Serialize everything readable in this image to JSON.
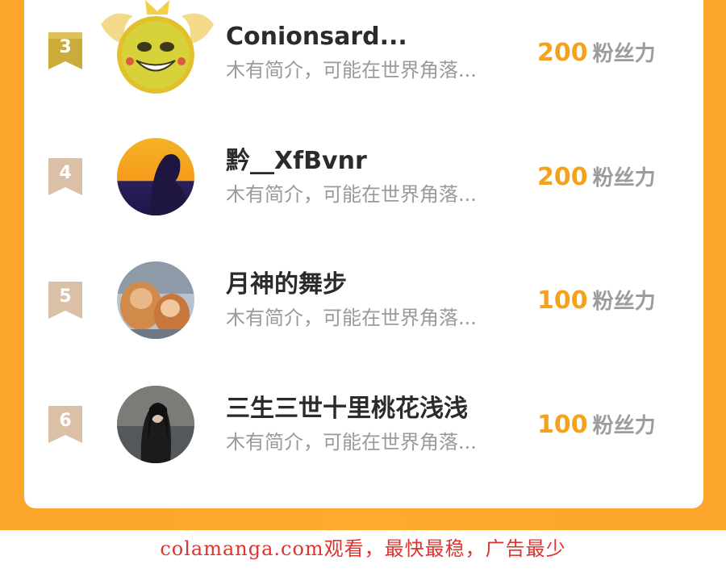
{
  "rankings": [
    {
      "rank": "3",
      "name": "Conionsard...",
      "description": "木有简介，可能在世界角落...",
      "score": "200",
      "score_unit": "粉丝力",
      "avatar": "yellow-meme-face-avatar",
      "crowned": true
    },
    {
      "rank": "4",
      "name": "黔__XfBvnr",
      "description": "木有简介，可能在世界角落...",
      "score": "200",
      "score_unit": "粉丝力",
      "avatar": "sunset-silhouette-avatar",
      "crowned": false
    },
    {
      "rank": "5",
      "name": "月神的舞步",
      "description": "木有简介，可能在世界角落...",
      "score": "100",
      "score_unit": "粉丝力",
      "avatar": "two-cats-avatar",
      "crowned": false
    },
    {
      "rank": "6",
      "name": "三生三世十里桃花浅浅",
      "description": "木有简介，可能在世界角落...",
      "score": "100",
      "score_unit": "粉丝力",
      "avatar": "dark-haired-figure-avatar",
      "crowned": false
    }
  ],
  "footer": {
    "watermark": "colamanga.com观看，最快最稳，广告最少"
  },
  "colors": {
    "background_orange": "#fba52a",
    "score": "#f5a21a",
    "watermark": "#e0322e",
    "rank_3_ribbon": "#c9a93a",
    "rank_other_ribbon": "#d8bfa4"
  }
}
